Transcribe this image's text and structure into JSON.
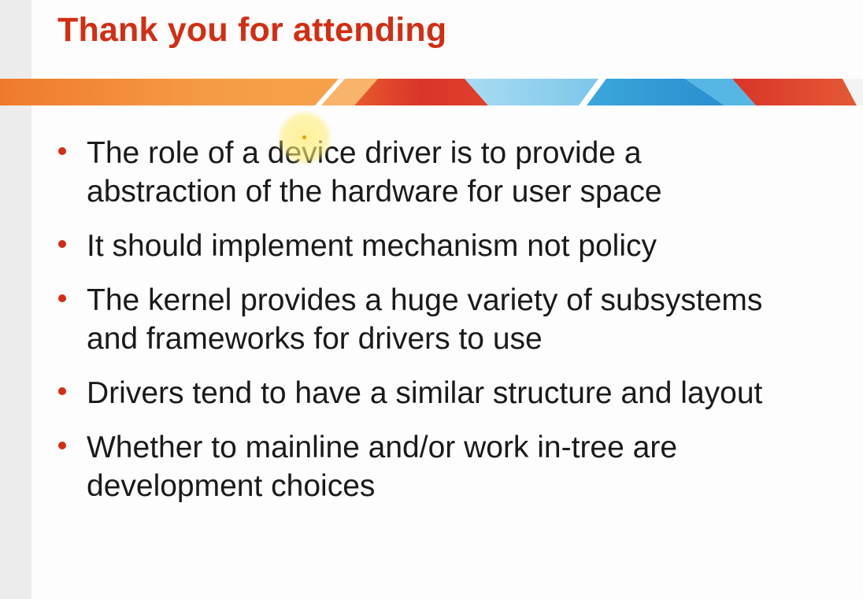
{
  "slide": {
    "title": "Thank you for attending",
    "bullets": [
      "The role of a device driver is to provide a abstraction of the hardware for user space",
      "It should implement mechanism not policy",
      "The kernel provides a huge variety of subsystems and frameworks for drivers to use",
      "Drivers tend to have a similar structure and layout",
      "Whether to mainline and/or work in-tree are development choices"
    ]
  },
  "colors": {
    "title": "#d42d12",
    "bullet_dot": "#d42d12",
    "banner_orange": "#f08a36",
    "banner_red": "#d9352a",
    "banner_blue": "#2e9fd8",
    "cursor_highlight": "#ffee78"
  },
  "icons": {
    "bullet": "red-dot",
    "cursor": "cursor-highlight"
  }
}
